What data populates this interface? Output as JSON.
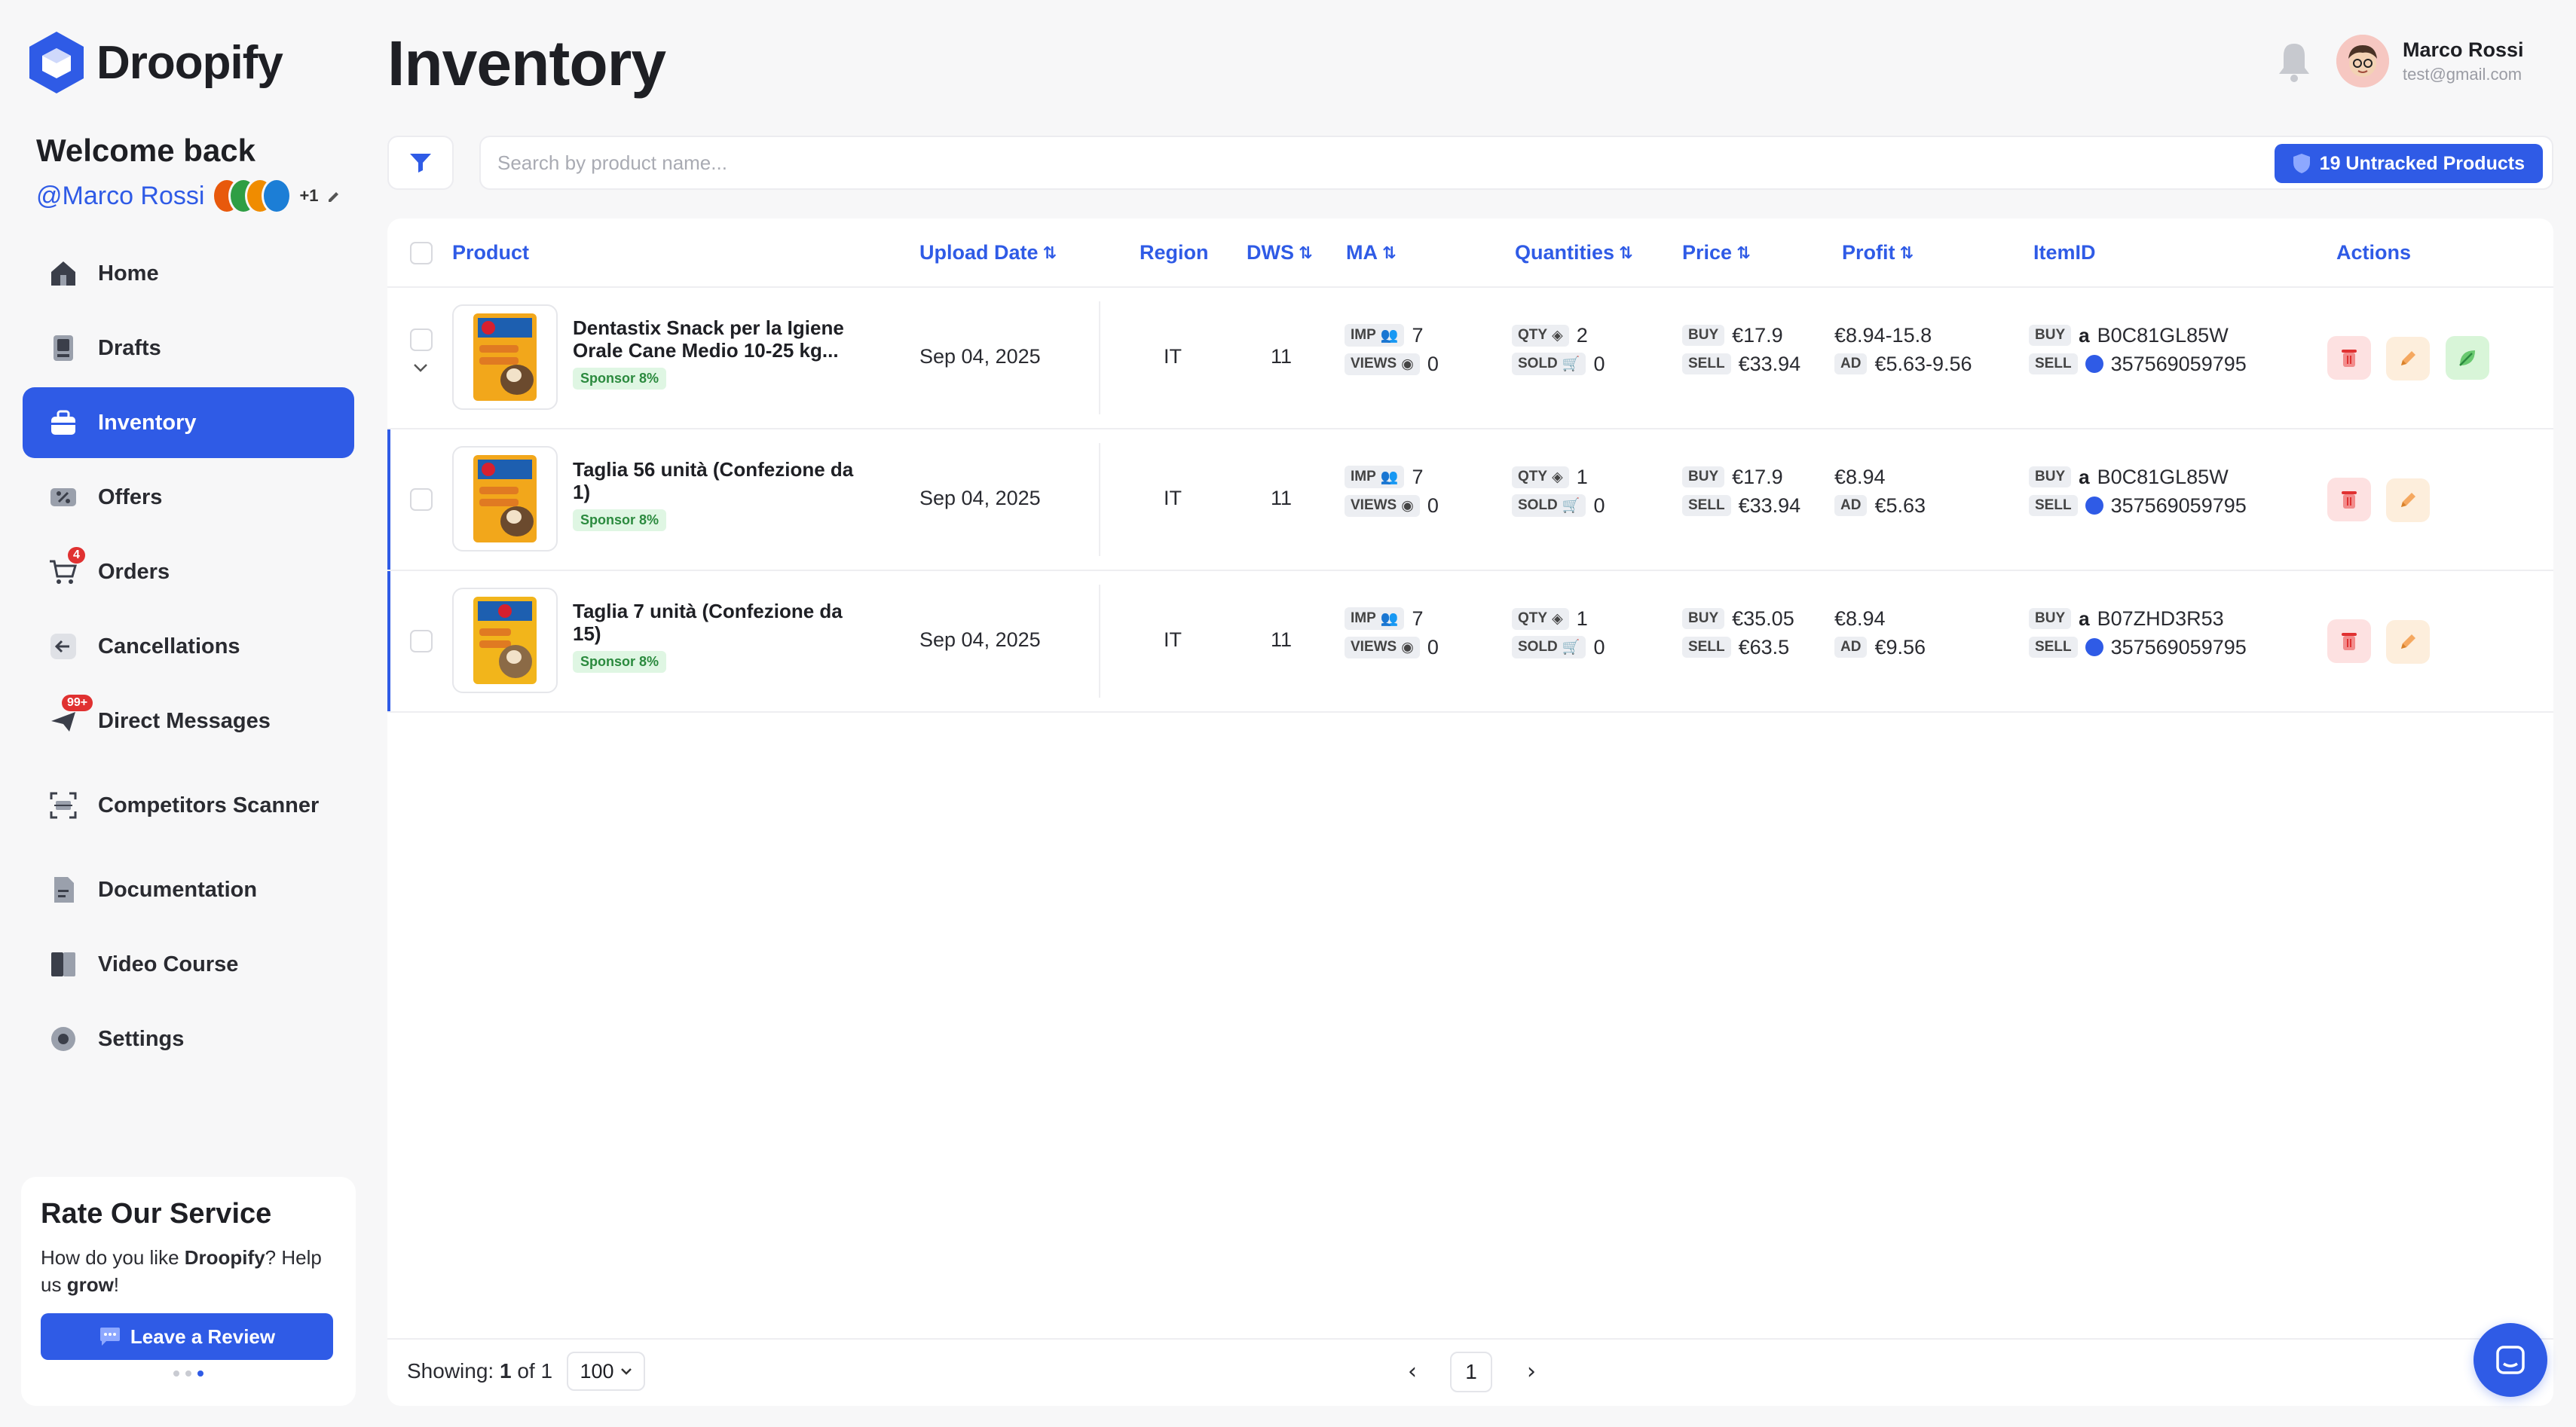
{
  "brand": {
    "name": "Droopify"
  },
  "welcome": {
    "title": "Welcome back",
    "handle": "@Marco Rossi",
    "extra_count": "+1"
  },
  "sidebar": {
    "items": [
      {
        "label": "Home",
        "icon": "home-icon"
      },
      {
        "label": "Drafts",
        "icon": "drafts-icon"
      },
      {
        "label": "Inventory",
        "icon": "inventory-icon",
        "active": true
      },
      {
        "label": "Offers",
        "icon": "offers-icon"
      },
      {
        "label": "Orders",
        "icon": "cart-icon",
        "badge": "4"
      },
      {
        "label": "Cancellations",
        "icon": "cancel-icon"
      },
      {
        "label": "Direct Messages",
        "icon": "message-icon",
        "badge": "99+"
      },
      {
        "label": "Competitors Scanner",
        "icon": "scanner-icon"
      },
      {
        "label": "Documentation",
        "icon": "document-icon"
      },
      {
        "label": "Video Course",
        "icon": "book-icon"
      },
      {
        "label": "Settings",
        "icon": "gear-icon"
      }
    ]
  },
  "rate": {
    "title": "Rate Our Service",
    "text_prefix": "How do you like ",
    "text_brand": "Droopify",
    "text_mid": "? Help us ",
    "text_bold": "grow",
    "text_suffix": "!",
    "button": "Leave a Review"
  },
  "header": {
    "title": "Inventory"
  },
  "user": {
    "name": "Marco Rossi",
    "email": "test@gmail.com"
  },
  "search": {
    "placeholder": "Search by product name...",
    "value": ""
  },
  "untracked": {
    "label": "19 Untracked Products"
  },
  "table": {
    "columns": {
      "product": "Product",
      "upload_date": "Upload Date",
      "region": "Region",
      "dws": "DWS",
      "ma": "MA",
      "quantities": "Quantities",
      "price": "Price",
      "profit": "Profit",
      "itemid": "ItemID",
      "actions": "Actions"
    },
    "tags": {
      "imp": "IMP",
      "views": "VIEWS",
      "qty": "QTY",
      "sold": "SOLD",
      "buy": "BUY",
      "sell": "SELL",
      "ad": "AD"
    },
    "rows": [
      {
        "name": "Dentastix Snack per la Igiene Orale Cane Medio 10-25 kg...",
        "sponsor": "Sponsor 8%",
        "date": "Sep 04, 2025",
        "region": "IT",
        "dws": "11",
        "imp": "7",
        "views": "0",
        "qty": "2",
        "sold": "0",
        "buy_price": "€17.9",
        "sell_price": "€33.94",
        "profit": "€8.94-15.8",
        "ad": "€5.63-9.56",
        "asin": "B0C81GL85W",
        "ebay_id": "357569059795"
      },
      {
        "name": "Taglia 56 unità (Confezione da 1)",
        "sponsor": "Sponsor 8%",
        "date": "Sep 04, 2025",
        "region": "IT",
        "dws": "11",
        "imp": "7",
        "views": "0",
        "qty": "1",
        "sold": "0",
        "buy_price": "€17.9",
        "sell_price": "€33.94",
        "profit": "€8.94",
        "ad": "€5.63",
        "asin": "B0C81GL85W",
        "ebay_id": "357569059795"
      },
      {
        "name": "Taglia 7 unità (Confezione da 15)",
        "sponsor": "Sponsor 8%",
        "date": "Sep 04, 2025",
        "region": "IT",
        "dws": "11",
        "imp": "7",
        "views": "0",
        "qty": "1",
        "sold": "0",
        "buy_price": "€35.05",
        "sell_price": "€63.5",
        "profit": "€8.94",
        "ad": "€9.56",
        "asin": "B07ZHD3R53",
        "ebay_id": "357569059795"
      }
    ]
  },
  "footer": {
    "showing_label": "Showing:",
    "page_of": "1",
    "of_label": "of",
    "total_pages": "1",
    "per_page": "100",
    "current_page": "1"
  },
  "colors": {
    "accent": "#2f5be6",
    "danger": "#e03131",
    "success": "#2b8a3e"
  }
}
